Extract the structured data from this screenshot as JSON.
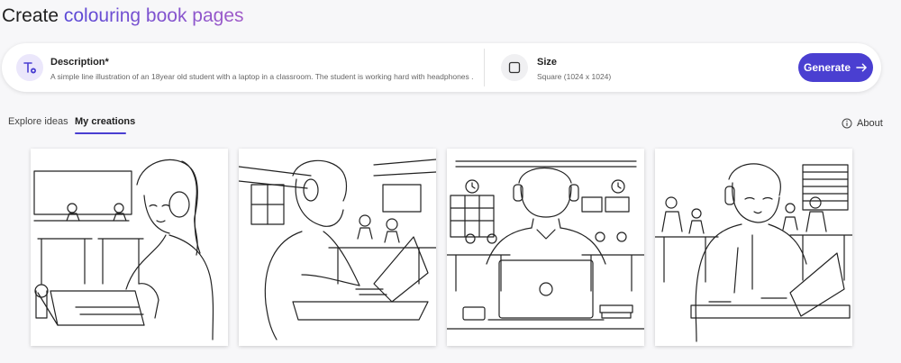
{
  "header": {
    "title_prefix": "Create",
    "title_accent": "colouring book pages"
  },
  "prompt": {
    "description_label": "Description*",
    "description_value": "A simple line illustration of an 18year old student with a laptop in a classroom. The student is working hard with headphones ...",
    "size_label": "Size",
    "size_value": "Square (1024 x 1024)",
    "generate_label": "Generate"
  },
  "tabs": [
    {
      "label": "Explore ideas",
      "active": false
    },
    {
      "label": "My creations",
      "active": true
    }
  ],
  "about_label": "About",
  "colors": {
    "accent": "#4a3fd1",
    "accent_gradient_end": "#a05ac8"
  }
}
